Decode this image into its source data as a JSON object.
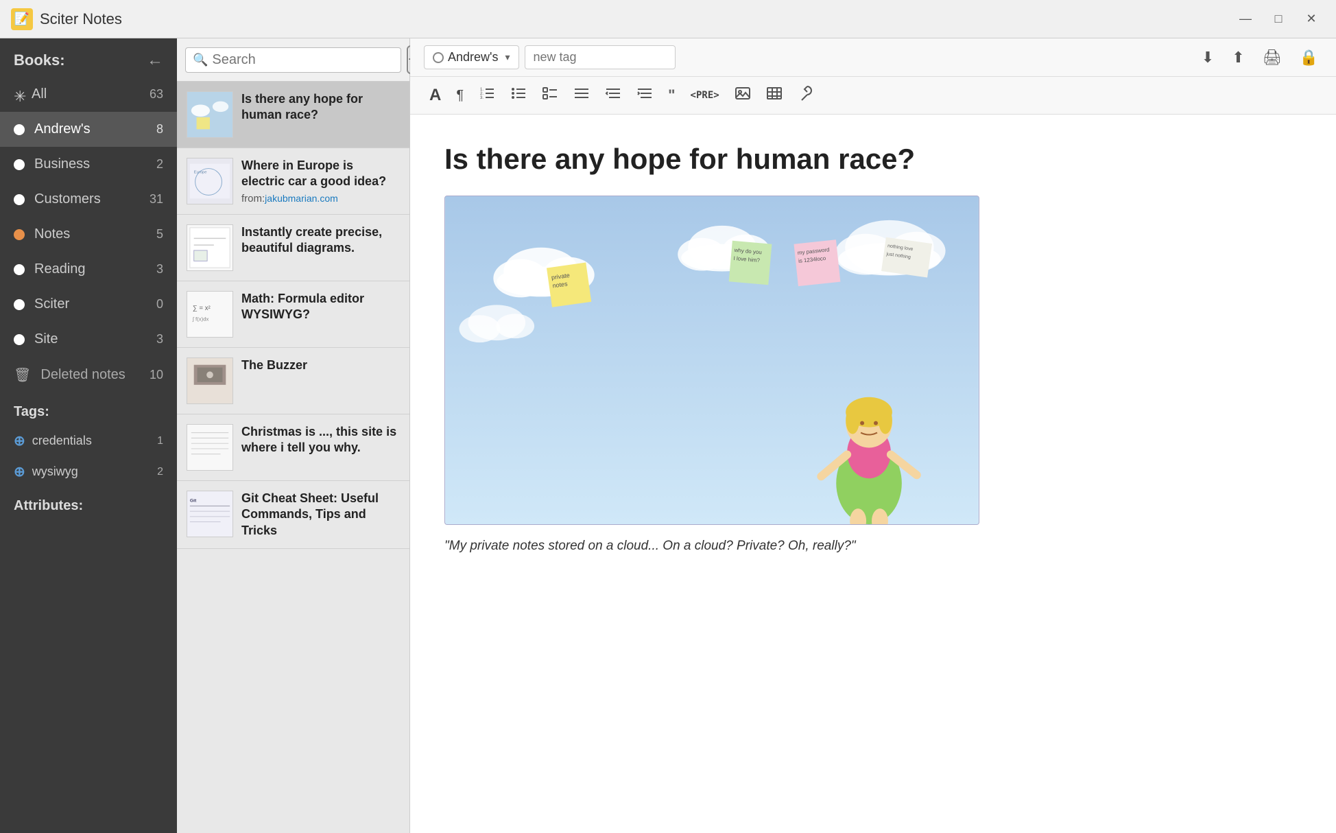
{
  "window": {
    "title": "Sciter Notes",
    "icon": "📝"
  },
  "titlebar": {
    "title": "Sciter Notes",
    "minimize_label": "—",
    "maximize_label": "□",
    "close_label": "✕"
  },
  "sidebar": {
    "header": "Books:",
    "back_label": "←",
    "items": [
      {
        "id": "all",
        "label": "All",
        "count": "63",
        "dot": "asterisk"
      },
      {
        "id": "andrews",
        "label": "Andrew's",
        "count": "8",
        "dot": "white",
        "active": true
      },
      {
        "id": "business",
        "label": "Business",
        "count": "2",
        "dot": "white"
      },
      {
        "id": "customers",
        "label": "Customers",
        "count": "31",
        "dot": "white"
      },
      {
        "id": "notes",
        "label": "Notes",
        "count": "5",
        "dot": "orange"
      },
      {
        "id": "reading",
        "label": "Reading",
        "count": "3",
        "dot": "white"
      },
      {
        "id": "sciter",
        "label": "Sciter",
        "count": "0",
        "dot": "white"
      },
      {
        "id": "site",
        "label": "Site",
        "count": "3",
        "dot": "white"
      }
    ],
    "deleted": {
      "label": "Deleted notes",
      "count": "10"
    },
    "tags_header": "Tags:",
    "tags": [
      {
        "label": "credentials",
        "count": "1"
      },
      {
        "label": "wysiwyg",
        "count": "2"
      }
    ],
    "attributes_header": "Attributes:"
  },
  "notes_list": {
    "search_placeholder": "Search",
    "add_label": "+",
    "notes": [
      {
        "id": "note1",
        "title": "Is there any hope for human race?",
        "subtitle": "",
        "active": true
      },
      {
        "id": "note2",
        "title": "Where in Europe is electric car a good idea?",
        "subtitle": "from:",
        "link": "jakubmarian.com"
      },
      {
        "id": "note3",
        "title": "Instantly create precise, beautiful diagrams.",
        "subtitle": ""
      },
      {
        "id": "note4",
        "title": "Math: Formula editor WYSIWYG?",
        "subtitle": ""
      },
      {
        "id": "note5",
        "title": "The Buzzer",
        "subtitle": ""
      },
      {
        "id": "note6",
        "title": "Christmas is ..., this site is where i tell you why.",
        "subtitle": ""
      },
      {
        "id": "note7",
        "title": "Git Cheat Sheet: Useful Commands, Tips and Tricks",
        "subtitle": ""
      }
    ]
  },
  "content": {
    "notebook_label": "Andrew's",
    "tag_placeholder": "new tag",
    "note_title": "Is there any hope for human race?",
    "note_quote": "\"My private notes stored on a cloud... On a cloud? Private? Oh, really?\"",
    "toolbar": {
      "download_icon": "⬇",
      "upload_icon": "⬆",
      "print_icon": "🖨",
      "lock_icon": "🔒"
    },
    "format": {
      "font_icon": "A",
      "paragraph_icon": "¶",
      "ordered_list_icon": "≡",
      "unordered_list_icon": "☰",
      "check_list_icon": "☑",
      "list_icon": "≣",
      "indent_dec_icon": "⇤",
      "indent_inc_icon": "⇥",
      "quote_icon": "❝",
      "pre_label": "<PRE>",
      "image_icon": "🖼",
      "table_icon": "⊞",
      "tools_icon": "⚙"
    }
  },
  "sticky_notes": {
    "note1": "private notes",
    "note2": "why do you I love him?",
    "note3": "my password is 1234loco",
    "note4": "nothing love just nothing"
  }
}
